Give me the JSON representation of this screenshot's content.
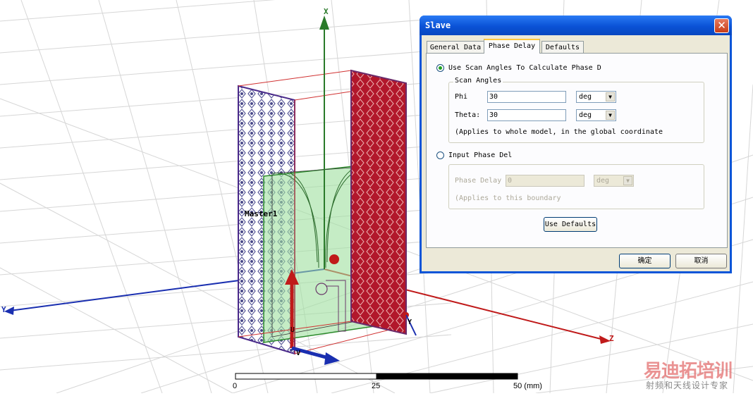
{
  "viewport": {
    "axes": {
      "x": "X",
      "y": "Y",
      "z": "Z",
      "y_small": "Y",
      "u": "U",
      "v": "V"
    },
    "labels": {
      "master": "Master1"
    },
    "ruler": {
      "ticks": [
        "0",
        "25",
        "50 (mm)"
      ]
    }
  },
  "dialog": {
    "title": "Slave",
    "tabs": [
      {
        "label": "General Data",
        "active": false
      },
      {
        "label": "Phase Delay",
        "active": true
      },
      {
        "label": "Defaults",
        "active": false
      }
    ],
    "use_scan": {
      "label": "Use Scan Angles To Calculate Phase D",
      "selected": true
    },
    "scan_group": {
      "title": "Scan Angles",
      "phi": {
        "label": "Phi",
        "value": "30",
        "unit": "deg"
      },
      "theta": {
        "label": "Theta:",
        "value": "30",
        "unit": "deg"
      },
      "note": "(Applies to whole model, in the global coordinate"
    },
    "input_phase": {
      "label": "Input Phase Del ",
      "selected": false
    },
    "phase_group": {
      "label": "Phase Delay",
      "value": "0",
      "unit": "deg",
      "note": "(Applies to this boundary"
    },
    "use_defaults_label": "Use Defaults",
    "ok_label": "确定",
    "cancel_label": "取消"
  },
  "watermark": {
    "main": "易迪拓培训",
    "sub": "射频和天线设计专家"
  },
  "colors": {
    "x_axis": "#2a7a2a",
    "y_axis": "#1a2fb0",
    "z_axis": "#c01a1a",
    "slave_face": "#b2172b",
    "master_face": "#3a3a8a"
  }
}
